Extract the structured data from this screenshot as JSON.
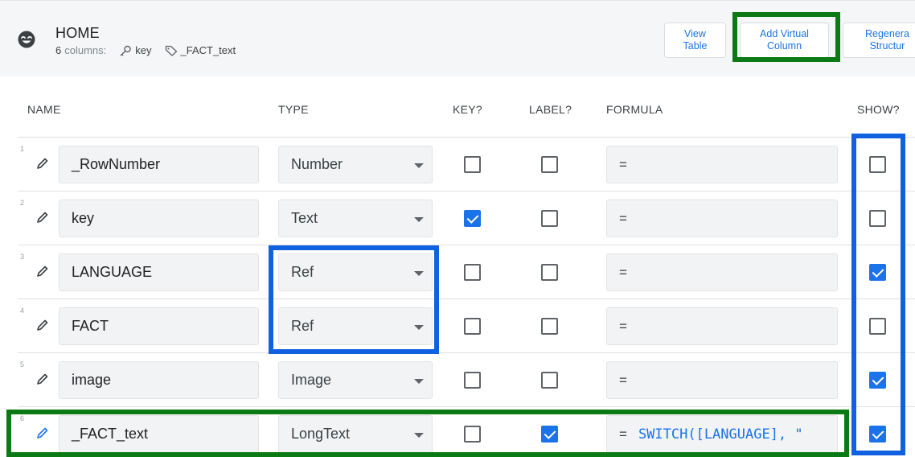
{
  "header": {
    "title": "HOME",
    "columns_count": "6",
    "columns_suffix": "columns:",
    "key_chip": "key",
    "label_chip": "_FACT_text",
    "icon": "smiley-face-icon"
  },
  "buttons": {
    "view_line1": "View",
    "view_line2": "Table",
    "add_line1": "Add Virtual",
    "add_line2": "Column",
    "regen_line1": "Regenera",
    "regen_line2": "Structur"
  },
  "columns": {
    "name": "NAME",
    "type": "TYPE",
    "key": "KEY?",
    "label": "LABEL?",
    "formula": "FORMULA",
    "show": "SHOW?"
  },
  "rows": [
    {
      "num": "1",
      "name": "_RowNumber",
      "type": "Number",
      "key": false,
      "label": false,
      "formula": "=",
      "formula_code": "",
      "show": false
    },
    {
      "num": "2",
      "name": "key",
      "type": "Text",
      "key": true,
      "label": false,
      "formula": "=",
      "formula_code": "",
      "show": false
    },
    {
      "num": "3",
      "name": "LANGUAGE",
      "type": "Ref",
      "key": false,
      "label": false,
      "formula": "=",
      "formula_code": "",
      "show": true
    },
    {
      "num": "4",
      "name": "FACT",
      "type": "Ref",
      "key": false,
      "label": false,
      "formula": "=",
      "formula_code": "",
      "show": false
    },
    {
      "num": "5",
      "name": "image",
      "type": "Image",
      "key": false,
      "label": false,
      "formula": "=",
      "formula_code": "",
      "show": true
    },
    {
      "num": "6",
      "name": "_FACT_text",
      "type": "LongText",
      "key": false,
      "label": true,
      "formula": "=",
      "formula_code": "SWITCH([LANGUAGE],  \"",
      "show": true
    }
  ],
  "colors": {
    "accent": "#1a73e8",
    "highlight_green": "#0b7a14",
    "highlight_blue": "#1160e0"
  }
}
